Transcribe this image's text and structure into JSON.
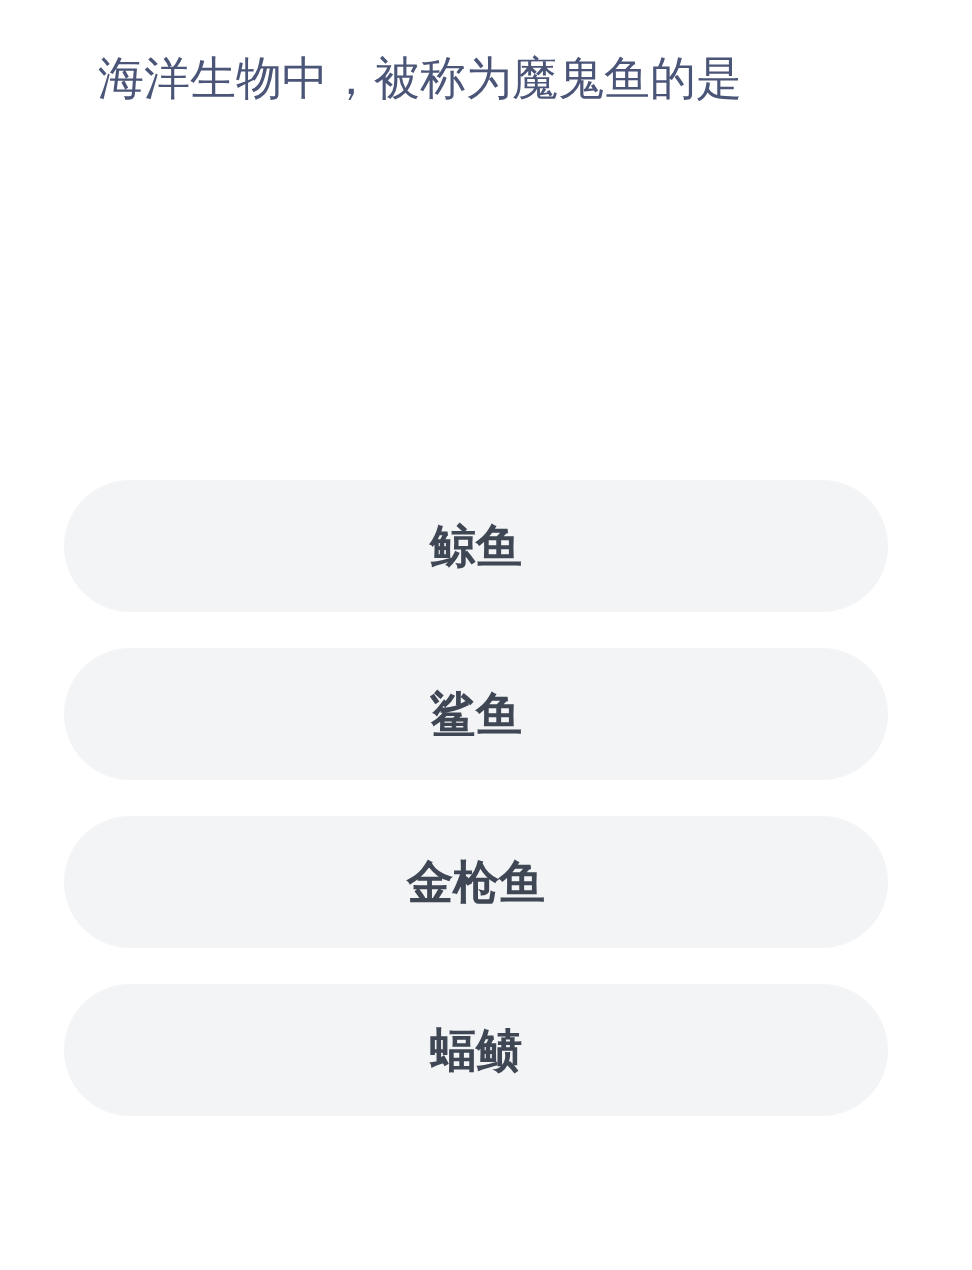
{
  "question": "海洋生物中，被称为魔鬼鱼的是",
  "options": [
    {
      "label": "鲸鱼"
    },
    {
      "label": "鲨鱼"
    },
    {
      "label": "金枪鱼"
    },
    {
      "label": "蝠鲼"
    }
  ]
}
